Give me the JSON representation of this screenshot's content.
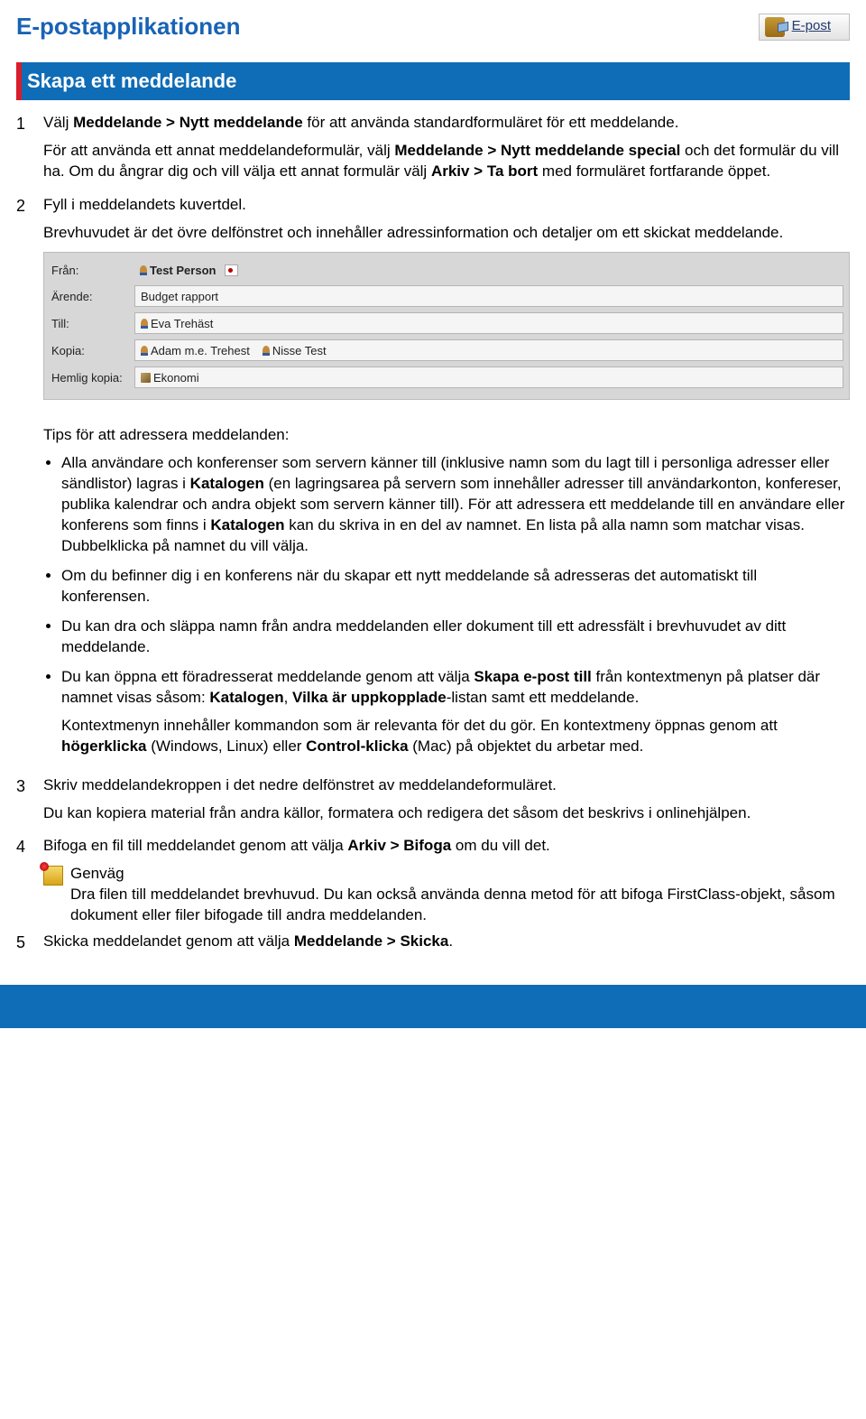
{
  "header": {
    "app_title": "E-postapplikationen",
    "box_label": "E-post"
  },
  "section": {
    "title": "Skapa ett meddelande"
  },
  "steps": {
    "s1": {
      "num": "1",
      "p1a": "Välj ",
      "p1b": "Meddelande > Nytt meddelande",
      "p1c": " för att använda standardformuläret för ett meddelande.",
      "p2a": "För att använda ett annat meddelandeformulär, välj ",
      "p2b": "Meddelande > Nytt meddelande special",
      "p2c": " och det formulär du vill ha. Om du ångrar dig och vill välja ett annat formulär välj ",
      "p2d": "Arkiv > Ta bort",
      "p2e": " med formuläret fortfarande öppet."
    },
    "s2": {
      "num": "2",
      "p1": "Fyll i meddelandets kuvertdel.",
      "p2": "Brevhuvudet är det övre delfönstret och innehåller adressinformation och detaljer om ett skickat meddelande."
    },
    "form": {
      "from_label": "Från:",
      "from_value": "Test Person",
      "subject_label": "Ärende:",
      "subject_value": "Budget rapport",
      "to_label": "Till:",
      "to_value": "Eva Trehäst",
      "cc_label": "Kopia:",
      "cc_value1": "Adam m.e. Trehest",
      "cc_value2": "Nisse Test",
      "bcc_label": "Hemlig kopia:",
      "bcc_value": "Ekonomi"
    },
    "tips": {
      "lead": "Tips för att adressera meddelanden:",
      "b1a": "Alla användare och konferenser som servern känner till (inklusive namn som du lagt till i personliga adresser eller sändlistor) lagras i ",
      "b1b": "Katalogen",
      "b1c": " (en lagringsarea på servern som innehåller adresser till användarkonton, konfereser, publika kalendrar och andra objekt som servern känner till). För att adressera ett meddelande till en användare eller konferens som finns i ",
      "b1d": "Katalogen",
      "b1e": " kan du skriva in en del av namnet. En lista på alla namn som matchar visas. Dubbelklicka på namnet du vill välja.",
      "b2": "Om du befinner dig i en konferens när du skapar ett nytt meddelande så adresseras det automatiskt till konferensen.",
      "b3": "Du kan dra och släppa namn från andra meddelanden eller dokument till ett adressfält i brevhuvudet av ditt meddelande.",
      "b4a": "Du kan öppna ett föradresserat meddelande genom att välja  ",
      "b4b": "Skapa e-post till",
      "b4c": " från kontextmenyn på platser där namnet visas såsom: ",
      "b4d": "Katalogen",
      "b4e": ", ",
      "b4f": "Vilka är uppkopplade",
      "b4g": "-listan samt ett meddelande.",
      "b4p2a": "Kontextmenyn innehåller kommandon som är relevanta för det du gör. En kontextmeny öppnas genom att ",
      "b4p2b": "högerklicka",
      "b4p2c": " (Windows, Linux) eller ",
      "b4p2d": "Control-klicka",
      "b4p2e": " (Mac) på objektet du arbetar med."
    },
    "s3": {
      "num": "3",
      "p1": "Skriv meddelandekroppen i det nedre delfönstret av meddelandeformuläret.",
      "p2": "Du kan kopiera material från andra källor, formatera och redigera det såsom det beskrivs i onlinehjälpen."
    },
    "s4": {
      "num": "4",
      "p1a": "Bifoga en fil till meddelandet genom att välja ",
      "p1b": "Arkiv > Bifoga",
      "p1c": " om du vill det.",
      "shortcut_title": "Genväg",
      "shortcut_body": "Dra filen till meddelandet brevhuvud. Du kan också använda denna metod för att bifoga FirstClass-objekt, såsom dokument eller filer bifogade till andra meddelanden."
    },
    "s5": {
      "num": "5",
      "p1a": "Skicka meddelandet genom att välja ",
      "p1b": "Meddelande > Skicka",
      "p1c": "."
    }
  }
}
